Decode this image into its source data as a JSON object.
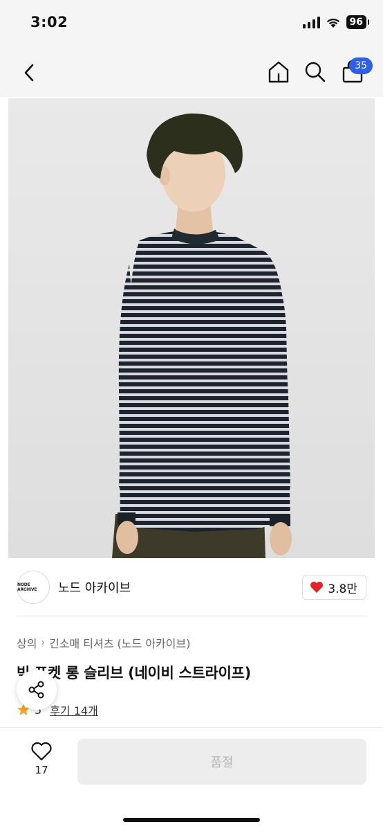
{
  "status_bar": {
    "time": "3:02",
    "battery": "96"
  },
  "nav": {
    "back_icon": "chevron-left-icon",
    "home_icon": "home-icon",
    "search_icon": "search-icon",
    "cart_icon": "shopping-bag-icon",
    "cart_badge": "35",
    "badge_color": "#2f5fe6"
  },
  "product": {
    "image_alt": "product-photo",
    "brand": {
      "name": "노드 아카이브",
      "logo_text": "NODE ARCHIVE"
    },
    "likes": {
      "count": "3.8만",
      "icon": "heart-filled-icon",
      "color": "#e0242b"
    },
    "breadcrumb": {
      "level1": "상의",
      "level2": "긴소매 티셔츠 (노드 아카이브)"
    },
    "title": "빅 포켓 롱 슬리브 (네이비 스트라이프)",
    "rating": {
      "score": "5",
      "reviews": "후기 14개"
    }
  },
  "bottom_bar": {
    "wish_count": "17",
    "buy_button": "품절"
  }
}
